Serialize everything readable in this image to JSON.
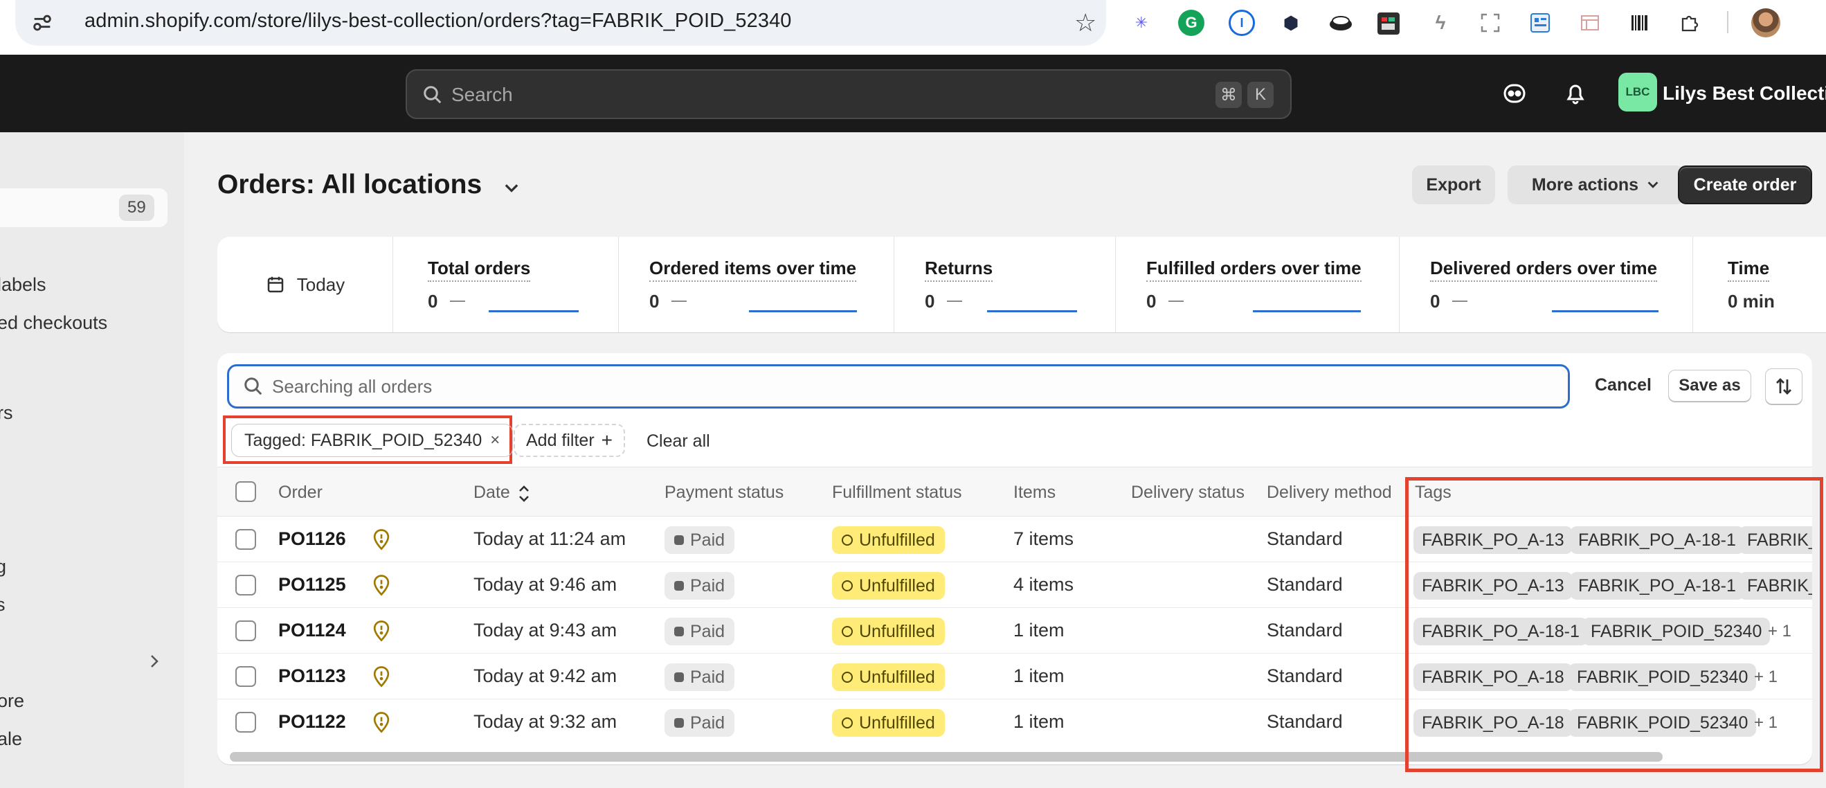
{
  "browser": {
    "url": "admin.shopify.com/store/lilys-best-collection/orders?tag=FABRIK_POID_52340",
    "extensions": [
      "sparkle-icon",
      "grammarly-icon",
      "password-icon",
      "shield-icon",
      "disc-icon",
      "book-icon",
      "link-icon",
      "screenshot-icon",
      "dashboard-icon",
      "window-icon",
      "barcode-icon",
      "puzzle-icon"
    ]
  },
  "topnav": {
    "search_placeholder": "Search",
    "shortcut_cmd": "⌘",
    "shortcut_key": "K",
    "store_initials": "LBC",
    "store_name": "Lilys Best Collection"
  },
  "sidebar": {
    "active_count": "59",
    "items": [
      "labels",
      "ed checkouts",
      "rs",
      "g",
      "s",
      "ore",
      "ale"
    ]
  },
  "page": {
    "title": "Orders:  All locations",
    "export_label": "Export",
    "more_actions_label": "More actions",
    "create_order_label": "Create order"
  },
  "metrics": {
    "date_label": "Today",
    "items": [
      {
        "label": "Total orders",
        "value": "0"
      },
      {
        "label": "Ordered items over time",
        "value": "0"
      },
      {
        "label": "Returns",
        "value": "0"
      },
      {
        "label": "Fulfilled orders over time",
        "value": "0"
      },
      {
        "label": "Delivered orders over time",
        "value": "0"
      },
      {
        "label": "Time",
        "value": "0 min"
      }
    ]
  },
  "orders": {
    "search_placeholder": "Searching all orders",
    "cancel_label": "Cancel",
    "save_as_label": "Save as",
    "filter_chip": "Tagged: FABRIK_POID_52340",
    "add_filter_label": "Add filter",
    "clear_all_label": "Clear all",
    "columns": [
      "Order",
      "Date",
      "Payment status",
      "Fulfillment status",
      "Items",
      "Delivery status",
      "Delivery method",
      "Tags"
    ],
    "rows": [
      {
        "order": "PO1126",
        "date": "Today at 11:24 am",
        "payment": "Paid",
        "fulfillment": "Unfulfilled",
        "items": "7 items",
        "delivery_status": "",
        "delivery_method": "Standard",
        "tags": [
          "FABRIK_PO_A-13",
          "FABRIK_PO_A-18-1",
          "FABRIK_"
        ],
        "more": ""
      },
      {
        "order": "PO1125",
        "date": "Today at 9:46 am",
        "payment": "Paid",
        "fulfillment": "Unfulfilled",
        "items": "4 items",
        "delivery_status": "",
        "delivery_method": "Standard",
        "tags": [
          "FABRIK_PO_A-13",
          "FABRIK_PO_A-18-1",
          "FABRIK_"
        ],
        "more": ""
      },
      {
        "order": "PO1124",
        "date": "Today at 9:43 am",
        "payment": "Paid",
        "fulfillment": "Unfulfilled",
        "items": "1 item",
        "delivery_status": "",
        "delivery_method": "Standard",
        "tags": [
          "FABRIK_PO_A-18-1",
          "FABRIK_POID_52340"
        ],
        "more": "+ 1"
      },
      {
        "order": "PO1123",
        "date": "Today at 9:42 am",
        "payment": "Paid",
        "fulfillment": "Unfulfilled",
        "items": "1 item",
        "delivery_status": "",
        "delivery_method": "Standard",
        "tags": [
          "FABRIK_PO_A-18",
          "FABRIK_POID_52340"
        ],
        "more": "+ 1"
      },
      {
        "order": "PO1122",
        "date": "Today at 9:32 am",
        "payment": "Paid",
        "fulfillment": "Unfulfilled",
        "items": "1 item",
        "delivery_status": "",
        "delivery_method": "Standard",
        "tags": [
          "FABRIK_PO_A-18",
          "FABRIK_POID_52340"
        ],
        "more": "+ 1"
      }
    ]
  },
  "colors": {
    "accent": "#2c6ecb",
    "highlight": "#e3432e",
    "unfulfilled_bg": "#ffeb78",
    "store_avatar": "#78e8a4",
    "topnav_bg": "#1a1a1a"
  }
}
